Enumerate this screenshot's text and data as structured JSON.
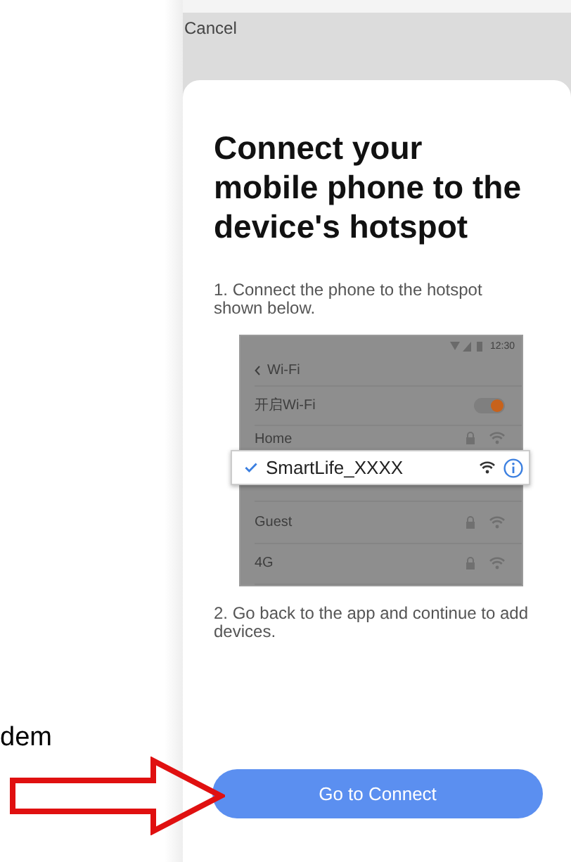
{
  "background_fragment": {
    "text": "dem"
  },
  "header": {
    "cancel": "Cancel"
  },
  "title": "Connect your mobile phone to the device's hotspot",
  "steps": [
    "1. Connect the phone to the hotspot shown below.",
    "2. Go back to the app and continue to add devices."
  ],
  "illustration": {
    "time": "12:30",
    "back_title": "Wi-Fi",
    "toggle": {
      "label": "开启Wi-Fi",
      "on": true
    },
    "networks": [
      {
        "name": "Home",
        "locked": true
      },
      {
        "name": "Guest",
        "locked": true
      },
      {
        "name": "4G",
        "locked": true
      }
    ],
    "popup": {
      "name": "SmartLife_XXXX",
      "selected": true
    }
  },
  "button": "Go to Connect"
}
